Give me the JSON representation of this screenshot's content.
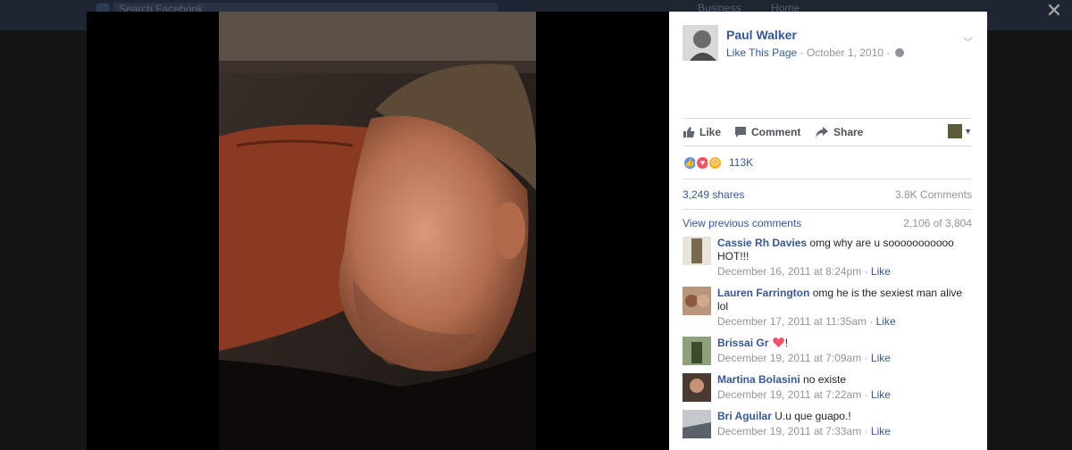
{
  "background_bar": {
    "search_placeholder": "Search Facebook",
    "nav": [
      "Business",
      "Home"
    ]
  },
  "close_label": "✕",
  "post": {
    "author": "Paul Walker",
    "like_page": "Like This Page",
    "date": "October 1, 2010",
    "separator": "·"
  },
  "actions": {
    "like": "Like",
    "comment": "Comment",
    "share": "Share"
  },
  "reactions": {
    "count": "113K",
    "types": [
      "like",
      "love",
      "sad"
    ]
  },
  "stats": {
    "shares": "3,249 shares",
    "comments": "3.8K Comments"
  },
  "comments_section": {
    "view_previous": "View previous comments",
    "progress": "2,106 of 3,804"
  },
  "comments": [
    {
      "name": "Cassie Rh Davies",
      "text": "omg why are u sooooooooooo HOT!!!",
      "time": "December 16, 2011 at 8:24pm",
      "like": "Like"
    },
    {
      "name": "Lauren Farrington",
      "text": "omg he is the sexiest man alive lol",
      "time": "December 17, 2011 at 11:35am",
      "like": "Like"
    },
    {
      "name": "Brissai Gr",
      "text": "!",
      "time": "December 19, 2011 at 7:09am",
      "like": "Like"
    },
    {
      "name": "Martina Bolasini",
      "text": "no existe",
      "time": "December 19, 2011 at 7:22am",
      "like": "Like"
    },
    {
      "name": "Bri Aguilar",
      "text": "U.u que guapo.!",
      "time": "December 19, 2011 at 7:33am",
      "like": "Like"
    }
  ],
  "colors": {
    "link": "#365899",
    "meta": "#90949c",
    "like_reaction": "#5890ff",
    "love_reaction": "#f25268",
    "sad_reaction": "#f7b125"
  }
}
